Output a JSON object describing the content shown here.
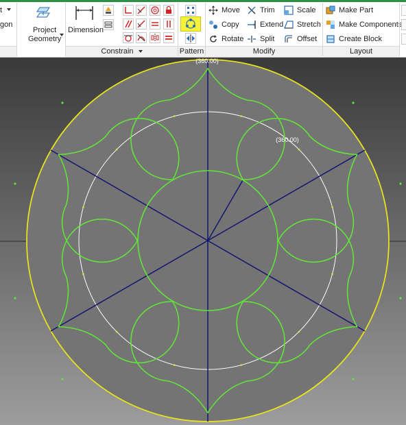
{
  "ribbon": {
    "left_cut": {
      "item1": "t",
      "item2": "gon"
    },
    "project_geometry": {
      "line1": "Project",
      "line2": "Geometry"
    },
    "dimension": "Dimension",
    "groups": {
      "constrain": "Constrain",
      "pattern": "Pattern",
      "modify": "Modify",
      "layout": "Layout"
    },
    "modify": {
      "move": "Move",
      "copy": "Copy",
      "rotate": "Rotate",
      "trim": "Trim",
      "extend": "Extend",
      "split": "Split",
      "scale": "Scale",
      "stretch": "Stretch",
      "offset": "Offset"
    },
    "layout": {
      "make_part": "Make Part",
      "make_components": "Make Components",
      "create_block": "Create Block"
    },
    "icons": [
      "point-icon",
      "polygon-icon",
      "project-geometry-icon",
      "dimension-icon",
      "coincident-icon",
      "collinear-icon",
      "concentric-icon",
      "fix-icon",
      "parallel-icon",
      "perpendicular-icon",
      "horizontal-icon",
      "vertical-icon",
      "tangent-icon",
      "smooth-icon",
      "symmetric-icon",
      "equal-icon",
      "show-constraints-icon",
      "auto-dimension-icon",
      "rectangular-pattern-icon",
      "circular-pattern-icon",
      "mirror-icon",
      "move-icon",
      "copy-icon",
      "rotate-icon",
      "trim-icon",
      "extend-icon",
      "split-icon",
      "scale-icon",
      "stretch-icon",
      "offset-icon",
      "make-part-icon",
      "make-components-icon",
      "create-block-icon"
    ]
  },
  "canvas": {
    "dimension_top": "(360.00)",
    "dimension_inner": "(360.00)",
    "colors": {
      "outer_circle": "#e6e21f",
      "profile": "#63e23a",
      "construction": "#ffffff",
      "lines": "#151570",
      "axis": "#2a2a2a"
    }
  }
}
